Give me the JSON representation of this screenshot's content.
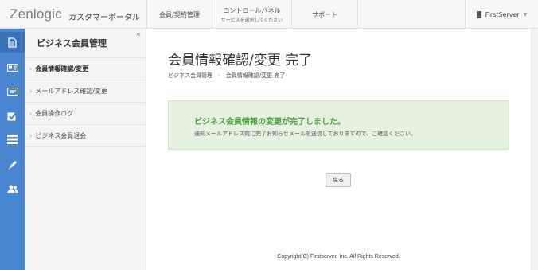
{
  "header": {
    "logo": "Zenlogic",
    "portal": "カスタマーポータル",
    "nav": [
      {
        "label": "会員/契約管理",
        "sub": ""
      },
      {
        "label": "コントロールパネル",
        "sub": "サービスを選択してください"
      },
      {
        "label": "サポート",
        "sub": ""
      }
    ],
    "user": "FirstServer"
  },
  "iconbar": {
    "icons": [
      "document-icon",
      "id-card-icon",
      "card-icon",
      "checkbox-icon",
      "server-icon",
      "pen-icon",
      "users-icon"
    ]
  },
  "sidebar": {
    "title": "ビジネス会員管理",
    "collapse": "«",
    "items": [
      {
        "label": "会員情報確認/変更"
      },
      {
        "label": "メールアドレス確認/変更"
      },
      {
        "label": "会員操作ログ"
      },
      {
        "label": "ビジネス会員退会"
      }
    ]
  },
  "main": {
    "title": "会員情報確認/変更 完了",
    "breadcrumb": [
      "ビジネス会員管理",
      "会員情報確認/変更 完了"
    ],
    "alert_title": "ビジネス会員情報の変更が完了しました。",
    "alert_text": "通知メールアドレス宛に完了お知らせメールを送信しておりますので、ご確認ください。",
    "back_label": "戻る",
    "footer": "Copyright(C) Firstserver, Inc. All Rights Reserved."
  }
}
